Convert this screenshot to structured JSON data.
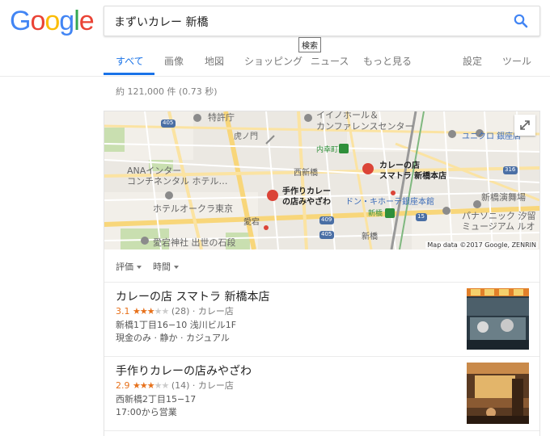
{
  "logo": {
    "text": "Google",
    "letters": [
      "G",
      "o",
      "o",
      "g",
      "l",
      "e"
    ],
    "colors": [
      "#4285F4",
      "#EA4335",
      "#FBBC05",
      "#4285F4",
      "#34A853",
      "#EA4335"
    ]
  },
  "search": {
    "query": "まずいカレー 新橋",
    "icon": "search-icon",
    "tooltip": "検索"
  },
  "tabs": {
    "all": "すべて",
    "images": "画像",
    "maps": "地図",
    "shopping": "ショッピング",
    "news": "ニュース",
    "more": "もっと見る",
    "settings": "設定",
    "tools": "ツール"
  },
  "result_stats": "約 121,000 件 (0.73 秒)",
  "map": {
    "attribution": "Map data ©2017 Google, ZENRIN",
    "expand_icon": "expand-icon",
    "labels": {
      "patent_office": "特許庁",
      "hall": "イイノホール＆",
      "conference": "カンファレンスセンター",
      "uniqlo": "ユニクロ 銀座店",
      "toranomon": "虎ノ門",
      "uchisaiwaicho": "内幸町",
      "ana1": "ANAインター",
      "ana2": "コンチネンタル ホテル…",
      "nishishinbashi": "西新橋",
      "sumatra1": "カレーの店",
      "sumatra2": "スマトラ 新橋本店",
      "miyazawa1": "手作りカレー",
      "miyazawa2": "の店みやざわ",
      "donki": "ドン・キホーテ銀座本館",
      "shinbashi_st": "新橋",
      "shinbashi_theater": "新橋演舞場",
      "okura": "ホテルオークラ東京",
      "atago": "愛宕",
      "panasonic1": "パナソニック 汐留",
      "panasonic2": "ミュージアム ルオ",
      "shinbashi": "新橋",
      "atago_shrine": "愛宕神社 出世の石段",
      "r405a": "405",
      "r405b": "405",
      "r409": "409",
      "r316": "316",
      "r15": "15"
    }
  },
  "filters": {
    "rating": "評価",
    "hours": "時間"
  },
  "places": [
    {
      "name": "カレーの店 スマトラ 新橋本店",
      "rating": "3.1",
      "stars_on": "★★★",
      "stars_off": "★★",
      "reviews": "(28)",
      "category": "· カレー店",
      "address": "新橋1丁目16−10 浅川ビル1F",
      "extra": "現金のみ · 静か · カジュアル"
    },
    {
      "name": "手作りカレーの店みやざわ",
      "rating": "2.9",
      "stars_on": "★★★",
      "stars_off": "★★",
      "reviews": "(14)",
      "category": "· カレー店",
      "address": "西新橋2丁目15−17",
      "extra": "17:00から営業"
    }
  ]
}
